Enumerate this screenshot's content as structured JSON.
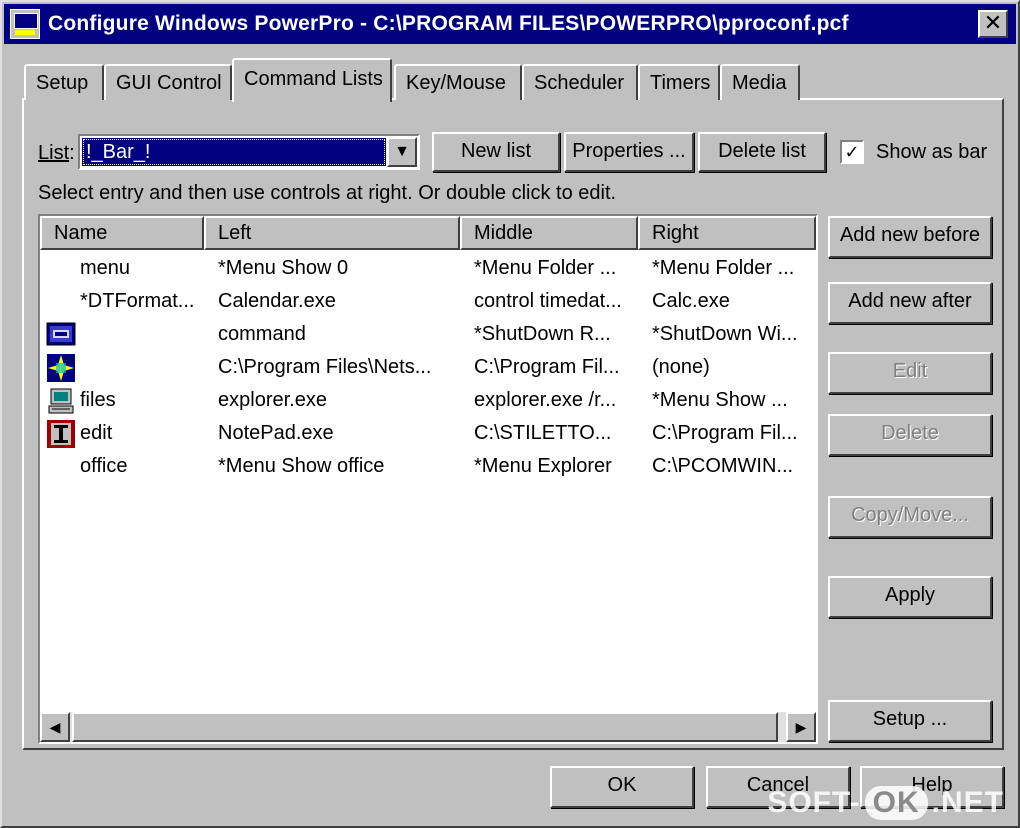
{
  "window": {
    "title": "Configure Windows PowerPro - C:\\PROGRAM FILES\\POWERPRO\\pproconf.pcf",
    "close_label": "✕"
  },
  "tabs": [
    "Setup",
    "GUI Control",
    "Command Lists",
    "Key/Mouse",
    "Scheduler",
    "Timers",
    "Media"
  ],
  "active_tab": "Command Lists",
  "list": {
    "label_prefix": "List",
    "label_suffix": ":",
    "selected_value": "!_Bar_!"
  },
  "buttons": {
    "new_list": "New list",
    "properties": "Properties ...",
    "delete_list": "Delete list",
    "add_new_before": "Add new before",
    "add_new_after": "Add new after",
    "edit": "Edit",
    "delete": "Delete",
    "copy_move": "Copy/Move...",
    "apply": "Apply",
    "setup": "Setup ...",
    "ok": "OK",
    "cancel": "Cancel",
    "help": "Help"
  },
  "show_as_bar": {
    "label": "Show as bar",
    "checked_mark": "✓"
  },
  "hint": "Select entry and then use controls at right.  Or double click to edit.",
  "table": {
    "columns": [
      "Name",
      "Left",
      "Middle",
      "Right"
    ],
    "rows": [
      {
        "icon": "none",
        "name": "menu",
        "left": "*Menu Show 0",
        "middle": "*Menu Folder ...",
        "right": "*Menu Folder ..."
      },
      {
        "icon": "none",
        "name": "*DTFormat...",
        "left": "Calendar.exe",
        "middle": "control timedat...",
        "right": "Calc.exe"
      },
      {
        "icon": "command-icon",
        "name": "",
        "left": "command",
        "middle": "*ShutDown R...",
        "right": "*ShutDown Wi..."
      },
      {
        "icon": "netscape-icon",
        "name": "",
        "left": "C:\\Program Files\\Nets...",
        "middle": "C:\\Program Fil...",
        "right": "(none)"
      },
      {
        "icon": "computer-icon",
        "name": "files",
        "left": "explorer.exe",
        "middle": "explorer.exe /r...",
        "right": "*Menu Show  ..."
      },
      {
        "icon": "text-editor-icon",
        "name": "edit",
        "left": "NotePad.exe",
        "middle": "C:\\STILETTO...",
        "right": "C:\\Program Fil..."
      },
      {
        "icon": "none",
        "name": "office",
        "left": "*Menu Show   office",
        "middle": "*Menu Explorer",
        "right": "C:\\PCOMWIN..."
      }
    ]
  },
  "scrollbar": {
    "left_arrow": "◀",
    "right_arrow": "▶"
  },
  "combo_arrow": "▼",
  "watermark": {
    "part1": "SOFT-",
    "part2": "OK",
    "part3": ".NET"
  }
}
